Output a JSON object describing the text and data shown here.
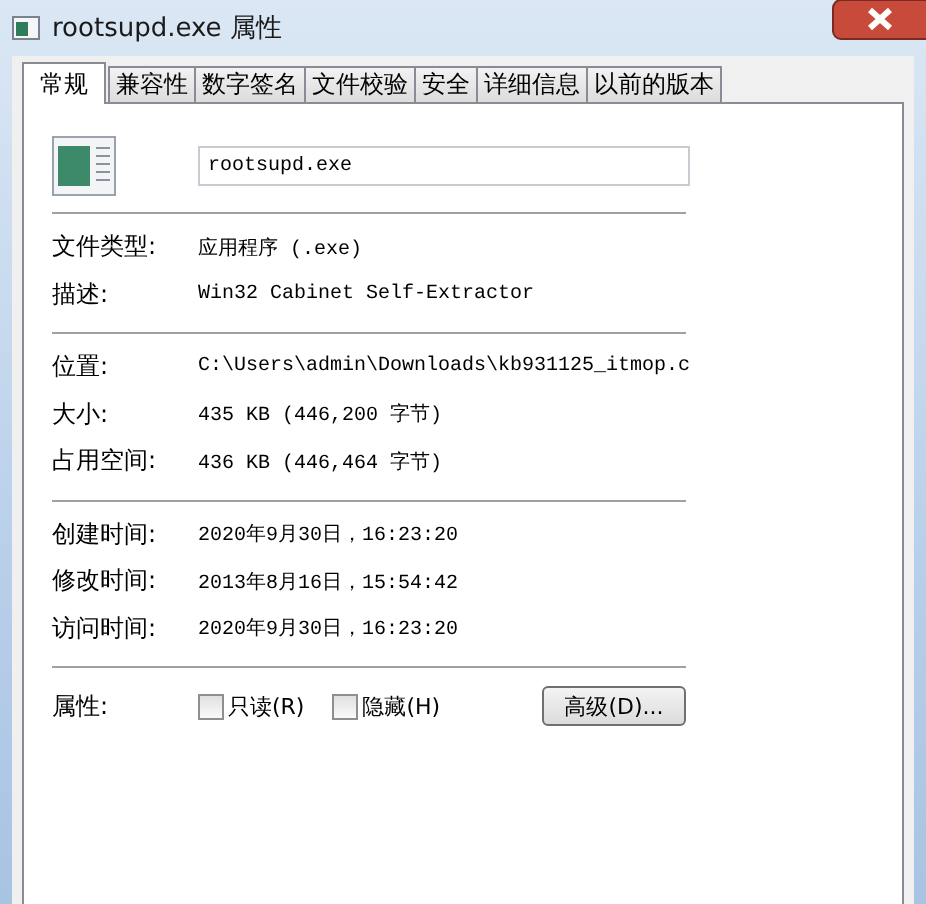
{
  "window": {
    "title": "rootsupd.exe 属性"
  },
  "tabs": [
    {
      "label": "常规",
      "selected": true
    },
    {
      "label": "兼容性",
      "selected": false
    },
    {
      "label": "数字签名",
      "selected": false
    },
    {
      "label": "文件校验",
      "selected": false
    },
    {
      "label": "安全",
      "selected": false
    },
    {
      "label": "详细信息",
      "selected": false
    },
    {
      "label": "以前的版本",
      "selected": false
    }
  ],
  "file": {
    "name": "rootsupd.exe"
  },
  "groups": [
    [
      {
        "label": "文件类型:",
        "value": "应用程序 (.exe)"
      },
      {
        "label": "描述:",
        "value": "Win32 Cabinet Self-Extractor"
      }
    ],
    [
      {
        "label": "位置:",
        "value": "C:\\Users\\admin\\Downloads\\kb931125_itmop.c"
      },
      {
        "label": "大小:",
        "value": "435 KB (446,200 字节)"
      },
      {
        "label": "占用空间:",
        "value": "436 KB (446,464 字节)"
      }
    ],
    [
      {
        "label": "创建时间:",
        "value": "2020年9月30日，16:23:20"
      },
      {
        "label": "修改时间:",
        "value": "2013年8月16日，15:54:42"
      },
      {
        "label": "访问时间:",
        "value": "2020年9月30日，16:23:20"
      }
    ]
  ],
  "attributes": {
    "label": "属性:",
    "checkboxes": [
      {
        "label": "只读(R)",
        "checked": false
      },
      {
        "label": "隐藏(H)",
        "checked": false
      }
    ],
    "advanced_button": "高级(D)..."
  }
}
